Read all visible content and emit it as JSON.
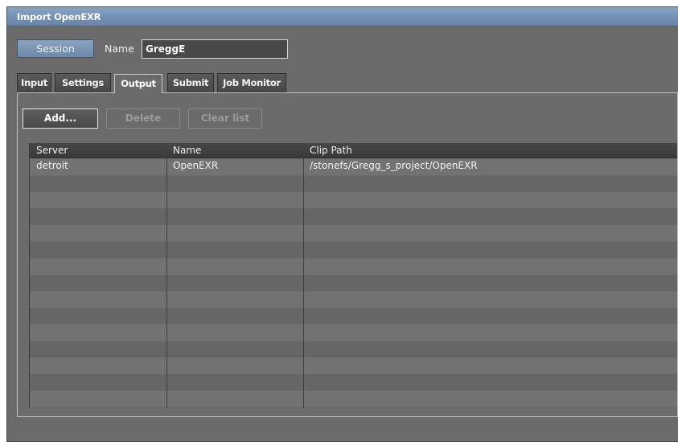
{
  "window": {
    "title": "Import OpenEXR"
  },
  "session": {
    "button_label": "Session",
    "name_label": "Name",
    "name_value": "GreggE"
  },
  "tabs": [
    {
      "label": "Input",
      "active": false
    },
    {
      "label": "Settings",
      "active": false
    },
    {
      "label": "Output",
      "active": true
    },
    {
      "label": "Submit",
      "active": false
    },
    {
      "label": "Job Monitor",
      "active": false
    }
  ],
  "toolbar": {
    "add_label": "Add...",
    "delete_label": "Delete",
    "clear_label": "Clear list"
  },
  "table": {
    "columns": [
      "Server",
      "Name",
      "Clip Path"
    ],
    "rows": [
      [
        "detroit",
        "OpenEXR",
        "/stonefs/Gregg_s_project/OpenEXR"
      ]
    ]
  },
  "colors": {
    "window_bg": "#6b6b6b",
    "titlebar": "#7390b4",
    "session_button": "#7a93b4"
  }
}
